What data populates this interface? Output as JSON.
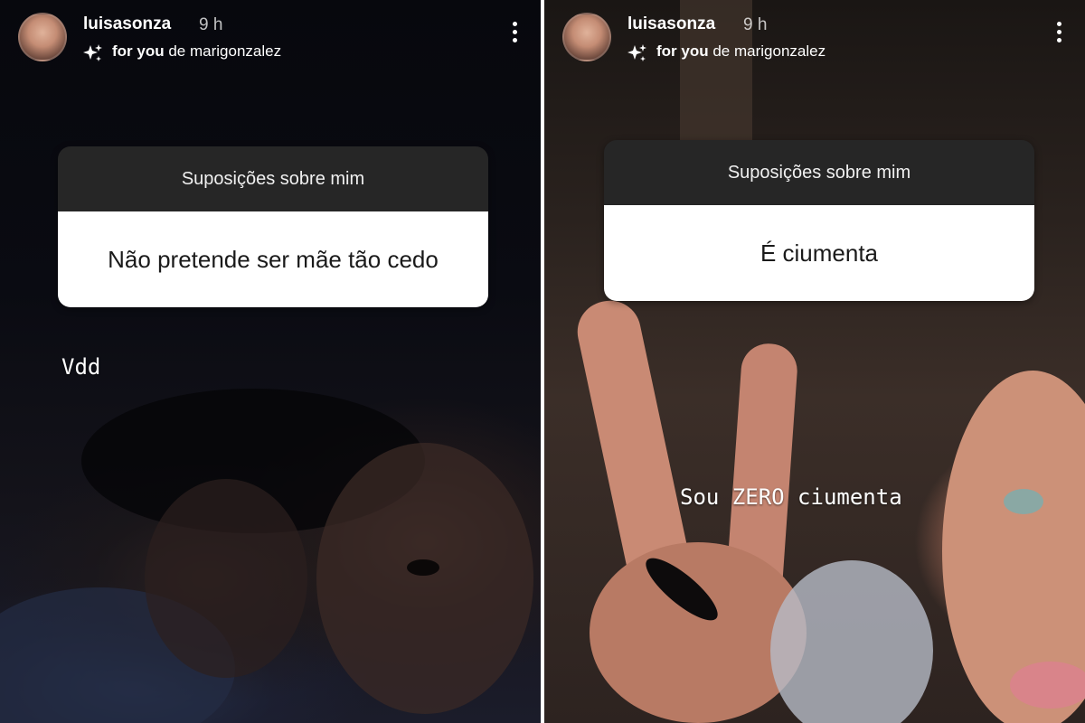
{
  "stories": [
    {
      "username": "luisasonza",
      "time": "9 h",
      "for_you_label": "for you",
      "de_label": "de",
      "author": "marigonzalez",
      "question_title": "Suposições sobre mim",
      "answer": "Não pretende ser mãe tão cedo",
      "caption": "Vdd"
    },
    {
      "username": "luisasonza",
      "time": "9 h",
      "for_you_label": "for you",
      "de_label": "de",
      "author": "marigonzalez",
      "question_title": "Suposições sobre mim",
      "answer": "É ciumenta",
      "caption": "Sou ZERO ciumenta"
    }
  ],
  "icons": {
    "sparkle": "sparkle-icon",
    "more": "more-vertical-icon",
    "avatar": "avatar"
  },
  "colors": {
    "card_header": "#262626",
    "card_body": "#ffffff",
    "text_light": "#ffffff"
  }
}
